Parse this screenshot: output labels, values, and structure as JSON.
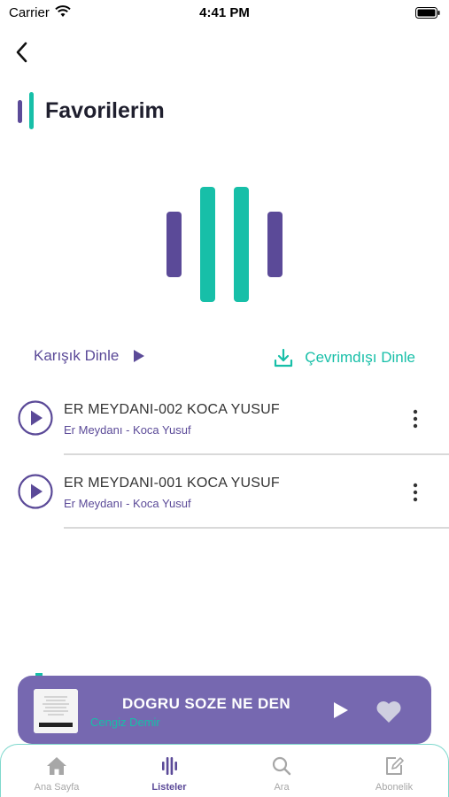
{
  "status_bar": {
    "carrier": "Carrier",
    "time": "4:41 PM"
  },
  "header": {
    "title": "Favorilerim"
  },
  "actions": {
    "shuffle_label": "Karışık Dinle",
    "offline_label": "Çevrimdışı Dinle"
  },
  "tracks": [
    {
      "title": "ER MEYDANI-002 KOCA YUSUF",
      "subtitle": "Er Meydanı - Koca Yusuf"
    },
    {
      "title": "ER MEYDANI-001 KOCA YUSUF",
      "subtitle": "Er Meydanı - Koca Yusuf"
    }
  ],
  "now_playing": {
    "title": "DOGRU SOZE NE DEN",
    "artist": "Cengiz Demir"
  },
  "tabs": [
    {
      "label": "Ana Sayfa",
      "icon": "home-icon",
      "active": false
    },
    {
      "label": "Listeler",
      "icon": "bars-icon",
      "active": true
    },
    {
      "label": "Ara",
      "icon": "search-icon",
      "active": false
    },
    {
      "label": "Abonelik",
      "icon": "edit-icon",
      "active": false
    }
  ],
  "colors": {
    "primary": "#5b4a98",
    "accent": "#17bfa8",
    "player_bg": "#7668b0",
    "inactive": "#a7a7a7"
  }
}
